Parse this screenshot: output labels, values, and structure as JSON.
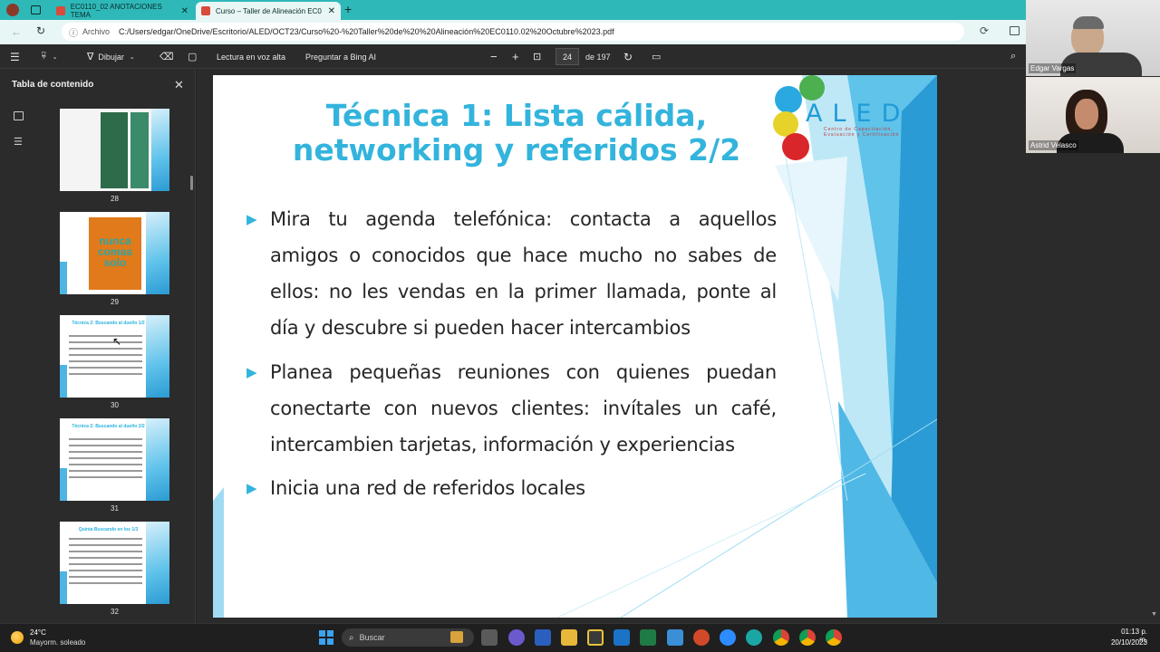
{
  "browser": {
    "tabs": [
      {
        "label": "EC0110_02 ANOTACIONES TEMA"
      },
      {
        "label": "Curso – Taller de Alineación EC0"
      }
    ],
    "address": {
      "prefix": "Archivo",
      "url": "C:/Users/edgar/OneDrive/Escritorio/ALED/OCT23/Curso%20-%20Taller%20de%20%20Alineación%20EC0110.02%20Octubre%2023.pdf"
    }
  },
  "pdf_toolbar": {
    "draw_label": "Dibujar",
    "read_aloud_label": "Lectura en voz alta",
    "ask_bing_label": "Preguntar a Bing AI",
    "page_current": "24",
    "page_total": "de 197"
  },
  "sidebar": {
    "title": "Tabla de contenido",
    "thumbnails": [
      {
        "page": "28"
      },
      {
        "page": "29",
        "book_title": "nunca comas solo"
      },
      {
        "page": "30",
        "heading": "Técnica 2: Buscando al dueño 1/2"
      },
      {
        "page": "31",
        "heading": "Técnica 2: Buscando al dueño 2/2"
      },
      {
        "page": "32",
        "heading": "Quinta Buscando en los 1/3"
      }
    ]
  },
  "slide": {
    "title_line1": "Técnica 1: Lista cálida,",
    "title_line2": "networking y referidos 2/2",
    "bullets": [
      "Mira tu agenda telefónica: contacta a aquellos amigos o conocidos que hace mucho no sabes de ellos: no les vendas en la primer llamada, ponte al día y descubre si pueden hacer intercambios",
      "Planea pequeñas reuniones con quienes puedan conectarte con nuevos clientes: invítales un café, intercambien tarjetas, información y experiencias",
      "Inicia una red de referidos locales"
    ],
    "logo_text": "ALED",
    "logo_subtext": "Centro de Capacitación, Evaluación y Certificación"
  },
  "participants": [
    {
      "name": "Edgar Vargas"
    },
    {
      "name": "Astrid Velasco"
    }
  ],
  "taskbar": {
    "weather_temp": "24°C",
    "weather_desc": "Mayorm. soleado",
    "search_placeholder": "Buscar",
    "time": "01:13 p. m.",
    "date": "20/10/2023"
  },
  "colors": {
    "accent": "#33b4dc",
    "tab_strip": "#2fb8b8",
    "viewer_bg": "#2b2b2b"
  }
}
